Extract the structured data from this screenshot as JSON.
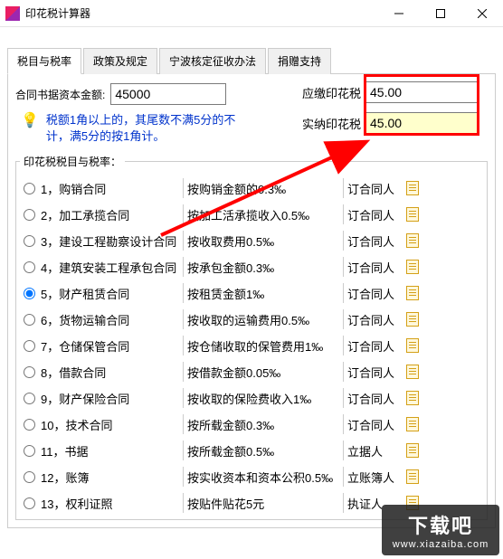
{
  "window": {
    "title": "印花税计算器"
  },
  "tabs": [
    "税目与税率",
    "政策及规定",
    "宁波核定征收办法",
    "捐赠支持"
  ],
  "amount": {
    "label": "合同书据资本金额:",
    "value": "45000"
  },
  "tip": "税额1角以上的，其尾数不满5分的不计，满5分的按1角计。",
  "results": {
    "due": {
      "label": "应缴印花税",
      "value": "45.00"
    },
    "paid": {
      "label": "实纳印花税",
      "value": "45.00"
    }
  },
  "group_legend": "印花税税目与税率：",
  "items": [
    {
      "n": "1，购销合同",
      "desc": "按购销金额的0.3‰",
      "payer": "订合同人"
    },
    {
      "n": "2，加工承揽合同",
      "desc": "按加工活承揽收入0.5‰",
      "payer": "订合同人"
    },
    {
      "n": "3，建设工程勘察设计合同",
      "desc": "按收取费用0.5‰",
      "payer": "订合同人"
    },
    {
      "n": "4，建筑安装工程承包合同",
      "desc": "按承包金额0.3‰",
      "payer": "订合同人"
    },
    {
      "n": "5，财产租赁合同",
      "desc": "按租赁金额1‰",
      "payer": "订合同人",
      "selected": true
    },
    {
      "n": "6，货物运输合同",
      "desc": "按收取的运输费用0.5‰",
      "payer": "订合同人"
    },
    {
      "n": "7，仓储保管合同",
      "desc": "按仓储收取的保管费用1‰",
      "payer": "订合同人"
    },
    {
      "n": "8，借款合同",
      "desc": "按借款金额0.05‰",
      "payer": "订合同人"
    },
    {
      "n": "9，财产保险合同",
      "desc": "按收取的保险费收入1‰",
      "payer": "订合同人"
    },
    {
      "n": "10，技术合同",
      "desc": "按所载金额0.3‰",
      "payer": "订合同人"
    },
    {
      "n": "11，书据",
      "desc": "按所载金额0.5‰",
      "payer": "立据人"
    },
    {
      "n": "12，账簿",
      "desc": "按实收资本和资本公积0.5‰",
      "payer": "立账簿人"
    },
    {
      "n": "13，权利证照",
      "desc": "按贴件贴花5元",
      "payer": "执证人"
    }
  ],
  "watermark": {
    "line1": "下载吧",
    "line2": "www.xiazaiba.com"
  }
}
